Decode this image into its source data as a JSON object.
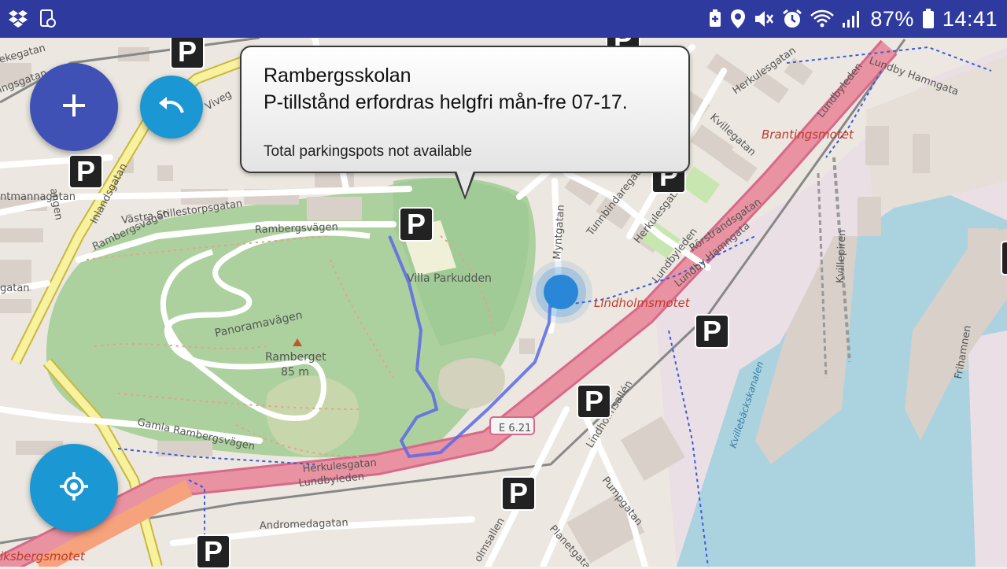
{
  "status_bar": {
    "battery_percent": "87%",
    "time": "14:41",
    "icons": [
      "dropbox-icon",
      "screenshot-icon",
      "battery-saver-icon",
      "location-icon",
      "mute-icon",
      "alarm-icon",
      "wifi-icon",
      "signal-icon",
      "battery-icon"
    ]
  },
  "popup": {
    "title": "Rambergsskolan",
    "permit_text": "P-tillstånd erfordras helgfri mån-fre 07-17.",
    "availability": "Total parkingspots not available"
  },
  "fabs": {
    "add_icon": "plus-icon",
    "undo_icon": "undo-icon",
    "locate_icon": "crosshair-icon"
  },
  "parking_marker_label": "P",
  "map": {
    "labels": {
      "rambergsvagen": "Rambergsvägen",
      "villa_parkudden": "Villa Parkudden",
      "panoramavagen": "Panoramavägen",
      "ramberget": "Ramberget",
      "ramberget_height": "85 m",
      "gamla_rambergsvagen": "Gamla Rambergsvägen",
      "herkulesgatan_south": "Herkulesgatan",
      "lundbyleden_south": "Lundbyleden",
      "e621": "E 6.21",
      "inlandsgatan": "Inlandsgatan",
      "vastra_stillestorpsgatan": "Västra Stillestorpsgatan",
      "rambergsvagen_west": "Rambergsvägen",
      "myntgatan": "Myntgatan",
      "tunnbindaregatan": "Tunnbindaregatan",
      "herkulesgatan_east": "Herkulesgatan",
      "lindholmsmotet": "Lindholmsmotet",
      "brantingsmotet": "Brantingsmotet",
      "lundbyleden_east": "Lundbyleden",
      "lundby_hamngata": "Lundby Hamngata",
      "lundby_hamngata_north": "Lundby Hamngata",
      "rorstrandsgatan": "Rörstrandsgatan",
      "kvillegatan": "Kvillegatan",
      "kvillepiren": "Kvillepiren",
      "frihamnen": "Frihamnen",
      "kvillebackskanalen": "Kvillebäckskanalen",
      "lindholmsallen": "Lindholmsallén",
      "pumpgatan": "Pumpgatan",
      "planetgatan": "Planetgatan",
      "andromedagatan": "Andromedagatan",
      "eriksbergsmotet": "iksbergsmotet",
      "holmsallen": "olmsallen",
      "mantmannagatan": "ntmannagatan",
      "gatan_left": "gatan",
      "ingsgatan": "ingsgatan",
      "viveg": "Viveg",
      "ekegatan": "ekegatan",
      "angen": "angen"
    }
  }
}
